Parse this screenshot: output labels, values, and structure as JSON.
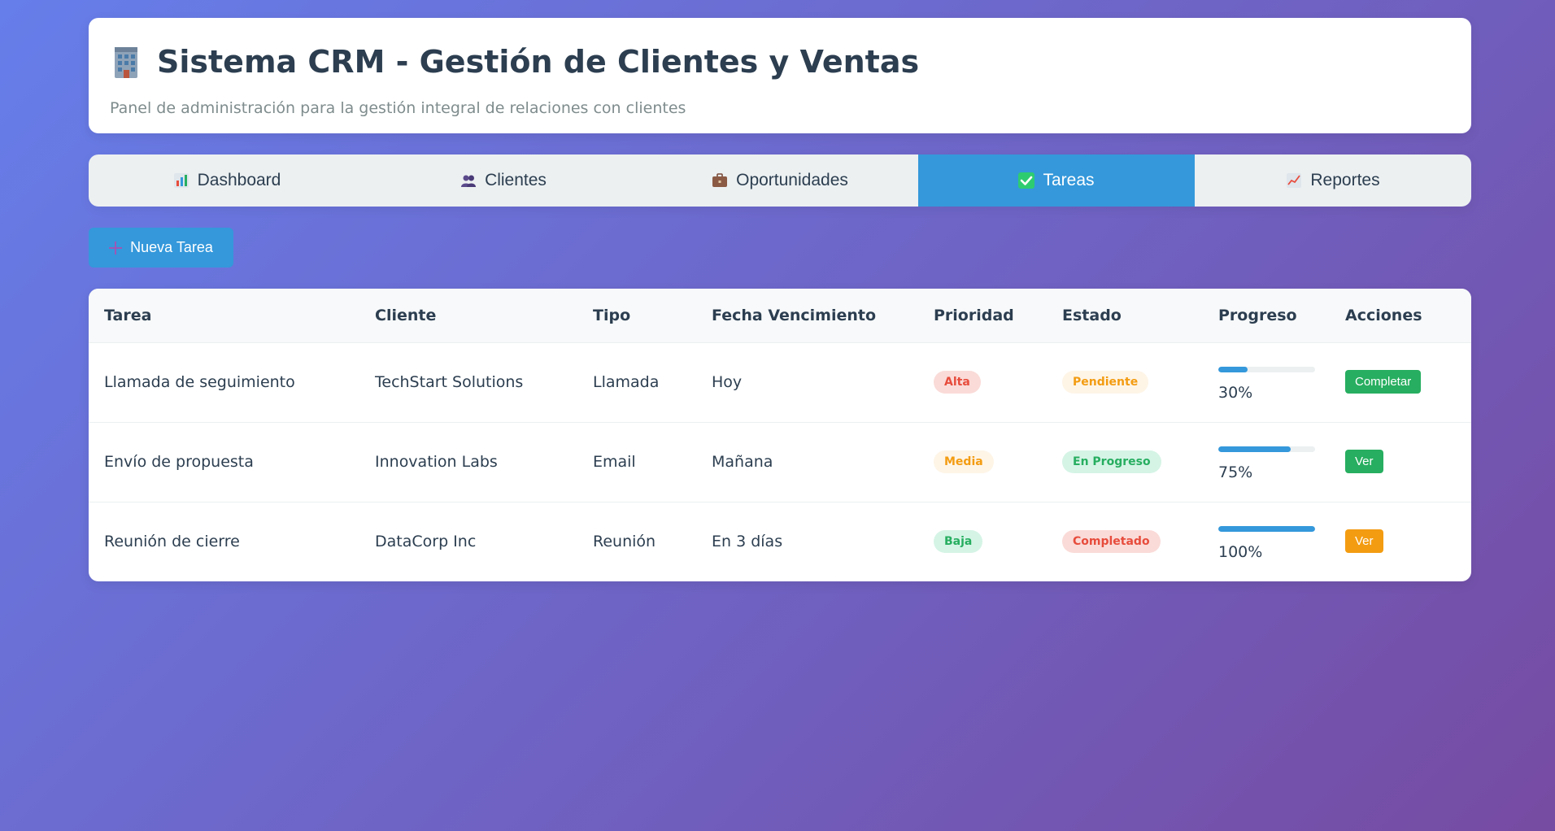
{
  "header": {
    "icon": "office-building-icon",
    "title": "Sistema CRM - Gestión de Clientes y Ventas",
    "subtitle": "Panel de administración para la gestión integral de relaciones con clientes"
  },
  "tabs": [
    {
      "label": "Dashboard",
      "icon": "bar-chart-icon",
      "active": false
    },
    {
      "label": "Clientes",
      "icon": "users-icon",
      "active": false
    },
    {
      "label": "Oportunidades",
      "icon": "briefcase-icon",
      "active": false
    },
    {
      "label": "Tareas",
      "icon": "checkmark-icon",
      "active": true
    },
    {
      "label": "Reportes",
      "icon": "line-chart-icon",
      "active": false
    }
  ],
  "new_task_button": {
    "label": "Nueva Tarea",
    "icon": "plus-icon"
  },
  "table": {
    "headers": [
      "Tarea",
      "Cliente",
      "Tipo",
      "Fecha Vencimiento",
      "Prioridad",
      "Estado",
      "Progreso",
      "Acciones"
    ],
    "rows": [
      {
        "tarea": "Llamada de seguimiento",
        "cliente": "TechStart Solutions",
        "tipo": "Llamada",
        "fecha": "Hoy",
        "prioridad": "Alta",
        "estado": "Pendiente",
        "progreso": 30,
        "progreso_label": "30%",
        "accion": "Completar",
        "accion_color": "#27ae60"
      },
      {
        "tarea": "Envío de propuesta",
        "cliente": "Innovation Labs",
        "tipo": "Email",
        "fecha": "Mañana",
        "prioridad": "Media",
        "estado": "En Progreso",
        "progreso": 75,
        "progreso_label": "75%",
        "accion": "Ver",
        "accion_color": "#27ae60"
      },
      {
        "tarea": "Reunión de cierre",
        "cliente": "DataCorp Inc",
        "tipo": "Reunión",
        "fecha": "En 3 días",
        "prioridad": "Baja",
        "estado": "Completado",
        "progreso": 100,
        "progreso_label": "100%",
        "accion": "Ver",
        "accion_color": "#f39c12"
      }
    ]
  },
  "colors": {
    "primary": "#3498db",
    "background_start": "#667eea",
    "background_end": "#764ba2",
    "text": "#2c3e50"
  }
}
